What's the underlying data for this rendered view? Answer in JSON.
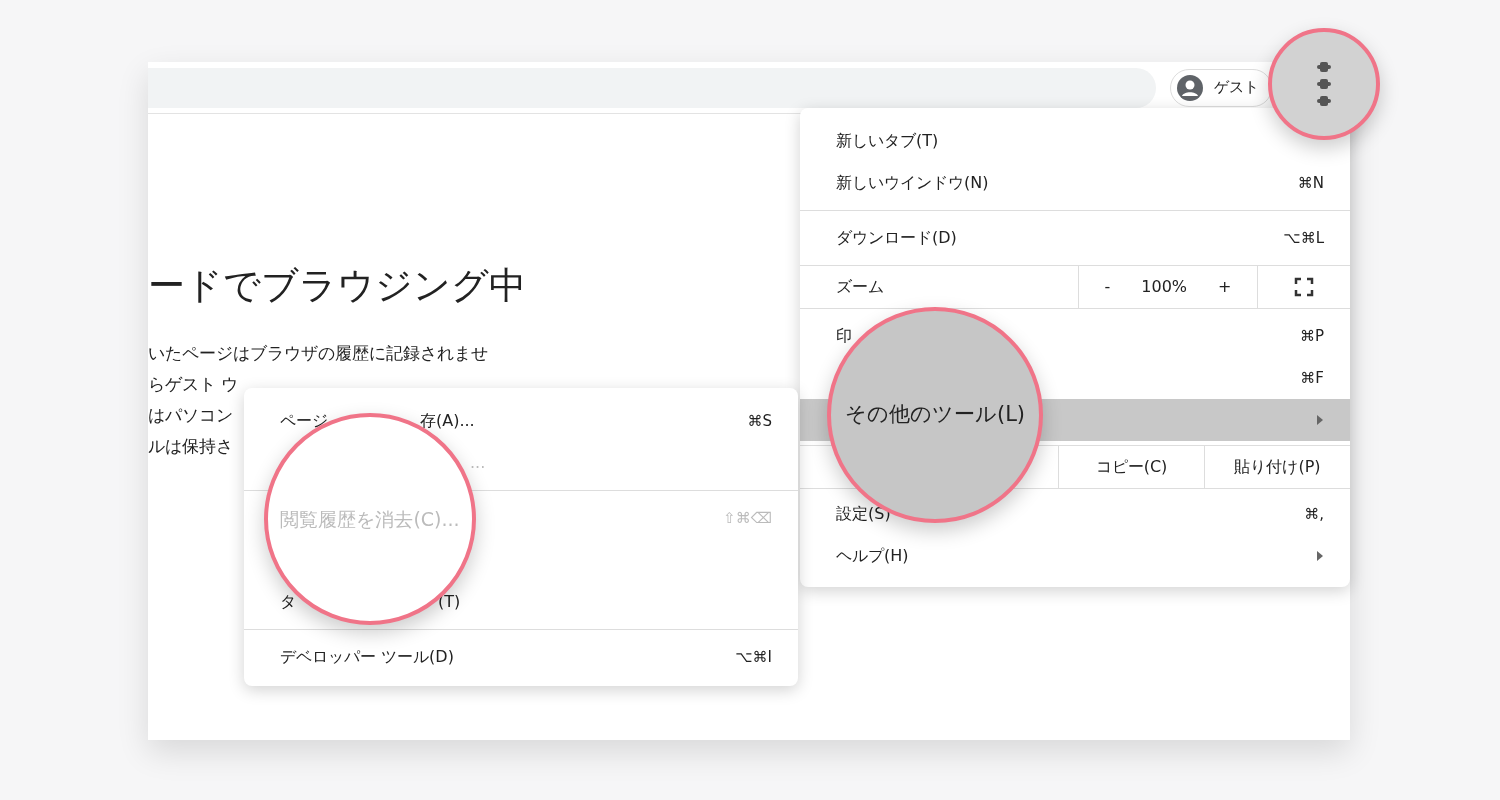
{
  "toolbar": {
    "profile_label": "ゲスト"
  },
  "page": {
    "heading": "ードでブラウジング中",
    "lines": [
      "いたページはブラウザの履歴に記録されませ",
      "らゲスト ウ",
      "はパソコン",
      "ルは保持さ"
    ]
  },
  "menu": {
    "items": [
      {
        "kind": "item",
        "label_parts": [
          "新しいタブ(T)"
        ],
        "selected": false
      },
      {
        "kind": "item",
        "label_parts": [
          "新しいウインドウ(N)"
        ],
        "shortcut": "⌘N",
        "selected": false
      },
      {
        "kind": "divider"
      },
      {
        "kind": "item",
        "label_parts": [
          "ダウンロード(D)"
        ],
        "shortcut": "⌥⌘L",
        "selected": false
      },
      {
        "kind": "divider"
      },
      {
        "kind": "zoom",
        "label": "ズーム",
        "minus": "-",
        "value": "100%",
        "plus": "+"
      },
      {
        "kind": "divider"
      },
      {
        "kind": "item",
        "label_parts": [
          "印"
        ],
        "shortcut": "⌘P",
        "selected": false
      },
      {
        "kind": "item",
        "shortcut": "⌘F",
        "selected": false
      },
      {
        "kind": "item",
        "selected": true,
        "submenu": true
      },
      {
        "kind": "edit",
        "cells": [
          "コピー(C)",
          "貼り付け(P)"
        ]
      },
      {
        "kind": "item",
        "label_parts": [
          "設定(S)"
        ],
        "shortcut": "⌘,",
        "selected": false
      },
      {
        "kind": "item",
        "label_parts": [
          "ヘルプ(H)"
        ],
        "selected": false,
        "submenu": true
      }
    ]
  },
  "submenu": {
    "items": [
      {
        "kind": "item",
        "label_parts": [
          "ページ",
          "存(A)..."
        ],
        "shortcut": "⌘S",
        "selected": false,
        "disabled": false
      },
      {
        "kind": "item",
        "label_parts": [
          "..."
        ],
        "selected": false,
        "disabled": true
      },
      {
        "kind": "divider"
      },
      {
        "kind": "item",
        "shortcut": "⇧⌘⌫",
        "selected": false,
        "disabled": true
      },
      {
        "kind": "item",
        "label_parts": [
          "タ",
          "(T)"
        ],
        "selected": false,
        "disabled": false
      },
      {
        "kind": "divider"
      },
      {
        "kind": "item",
        "label_parts": [
          "デベロッパー ツール(D)"
        ],
        "shortcut": "⌥⌘I",
        "selected": false,
        "disabled": false
      }
    ]
  },
  "magnifiers": [
    {
      "kind": "menu_button"
    },
    {
      "kind": "label",
      "label": "その他のツール(L)",
      "selected": true,
      "disabled": false
    },
    {
      "kind": "label",
      "label": "閲覧履歴を消去(C)...",
      "selected": false,
      "disabled": true
    }
  ]
}
